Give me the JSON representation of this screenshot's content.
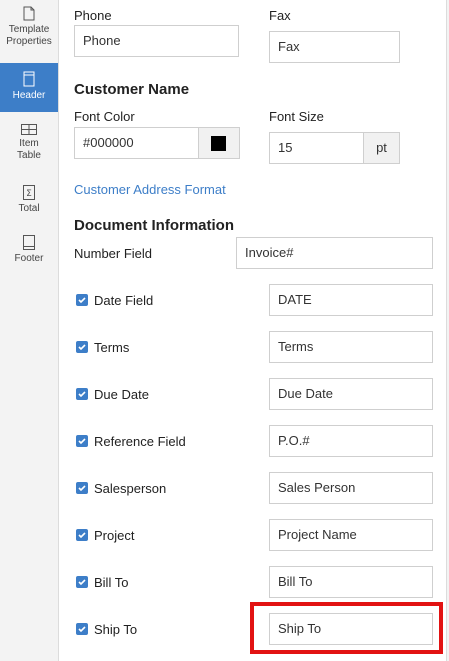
{
  "sidebar": {
    "items": [
      {
        "label_line1": "Template",
        "label_line2": "Properties",
        "icon": "document-icon",
        "active": false
      },
      {
        "label_line1": "Header",
        "label_line2": "",
        "icon": "header-icon",
        "active": true
      },
      {
        "label_line1": "Item",
        "label_line2": "Table",
        "icon": "table-icon",
        "active": false
      },
      {
        "label_line1": "Total",
        "label_line2": "",
        "icon": "sigma-icon",
        "active": false
      },
      {
        "label_line1": "Footer",
        "label_line2": "",
        "icon": "footer-icon",
        "active": false
      }
    ]
  },
  "contact": {
    "phone_label": "Phone",
    "phone_value": "Phone",
    "fax_label": "Fax",
    "fax_value": "Fax"
  },
  "customer_name": {
    "heading": "Customer Name",
    "font_color_label": "Font Color",
    "font_color_value": "#000000",
    "swatch_color": "#000000",
    "font_size_label": "Font Size",
    "font_size_value": "15",
    "font_size_unit": "pt",
    "address_format_link": "Customer Address Format"
  },
  "document_info": {
    "heading": "Document Information",
    "number_field_label": "Number Field",
    "number_field_value": "Invoice#",
    "rows": [
      {
        "label": "Date Field",
        "value": "DATE",
        "checked": true
      },
      {
        "label": "Terms",
        "value": "Terms",
        "checked": true
      },
      {
        "label": "Due Date",
        "value": "Due Date",
        "checked": true
      },
      {
        "label": "Reference Field",
        "value": "P.O.#",
        "checked": true
      },
      {
        "label": "Salesperson",
        "value": "Sales Person",
        "checked": true
      },
      {
        "label": "Project",
        "value": "Project Name",
        "checked": true
      },
      {
        "label": "Bill To",
        "value": "Bill To",
        "checked": true
      },
      {
        "label": "Ship To",
        "value": "Ship To",
        "checked": true
      }
    ]
  },
  "colors": {
    "accent": "#3d7ec8",
    "highlight": "#e21212"
  }
}
